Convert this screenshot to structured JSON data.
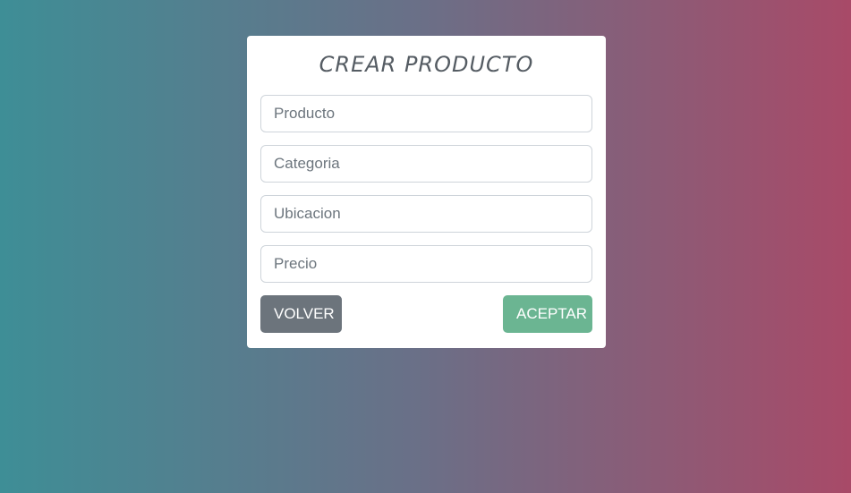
{
  "form": {
    "title": "CREAR PRODUCTO",
    "fields": {
      "producto_placeholder": "Producto",
      "categoria_placeholder": "Categoria",
      "ubicacion_placeholder": "Ubicacion",
      "precio_placeholder": "Precio"
    },
    "buttons": {
      "back_label": "VOLVER",
      "accept_label": "ACEPTAR"
    }
  },
  "colors": {
    "background_left": "#3e8e96",
    "background_right": "#a84a68",
    "back_button": "#6c747c",
    "accept_button": "#6bb592"
  }
}
